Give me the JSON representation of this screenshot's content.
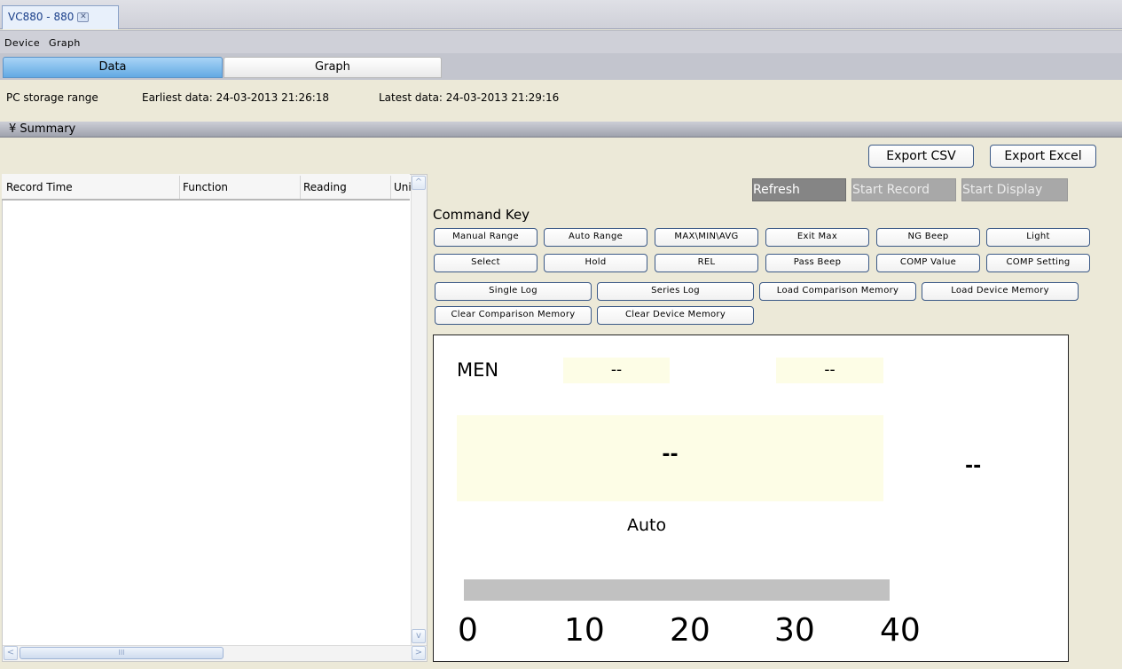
{
  "window": {
    "tab_title": "VC880 - 880",
    "close_glyph": "✕"
  },
  "menu": {
    "items": [
      "Device",
      "Graph"
    ]
  },
  "view_tabs": {
    "data": "Data",
    "graph": "Graph"
  },
  "storage": {
    "label": "PC storage range",
    "earliest": "Earliest data: 24-03-2013 21:26:18",
    "latest": "Latest data: 24-03-2013 21:29:16"
  },
  "summary": {
    "label": "Summary",
    "glyph": "¥"
  },
  "table": {
    "columns": [
      "Record Time",
      "Function",
      "Reading",
      "Uni"
    ],
    "rows": []
  },
  "scroll": {
    "up": "^",
    "down": "v",
    "left": "<",
    "right": ">",
    "grip": "III"
  },
  "export": {
    "csv": "Export CSV",
    "excel": "Export Excel"
  },
  "record": {
    "refresh": "Refresh",
    "start_record": "Start Record",
    "start_display": "Start Display"
  },
  "command_key": {
    "label": "Command Key",
    "row1": [
      "Manual Range",
      "Auto Range",
      "MAX\\MIN\\AVG",
      "Exit Max",
      "NG Beep",
      "Light"
    ],
    "row2": [
      "Select",
      "Hold",
      "REL",
      "Pass Beep",
      "COMP Value",
      "COMP Setting"
    ],
    "row3": [
      "Single Log",
      "Series Log",
      "Load Comparison Memory",
      "Load Device Memory"
    ],
    "row4": [
      "Clear Comparison Memory",
      "Clear Device Memory"
    ]
  },
  "display": {
    "men_label": "MEN",
    "sub1": "--",
    "sub2": "--",
    "main_value": "--",
    "side_value": "--",
    "range_mode": "Auto",
    "bar_fill": 0,
    "scale_labels": [
      "0",
      "10",
      "20",
      "30",
      "40"
    ]
  },
  "colors": {
    "accent_blue": "#62a9e3",
    "panel_yellow": "#fdfde6",
    "button_border": "#3c5a87"
  }
}
